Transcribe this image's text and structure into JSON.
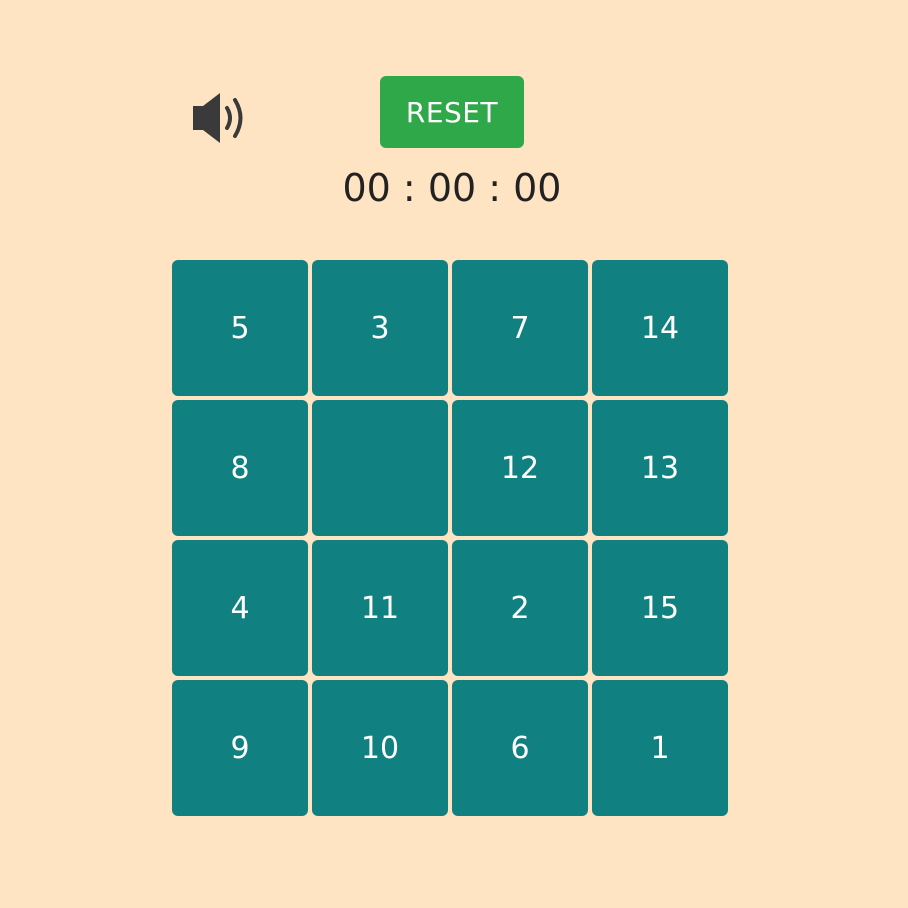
{
  "controls": {
    "sound_icon": "speaker-volume-icon",
    "reset_label": "RESET"
  },
  "timer": {
    "display": "00 : 00 : 00"
  },
  "board": {
    "rows": 4,
    "cols": 4,
    "tiles": [
      "5",
      "3",
      "7",
      "14",
      "8",
      "",
      "12",
      "13",
      "4",
      "11",
      "2",
      "15",
      "9",
      "10",
      "6",
      "1"
    ]
  },
  "colors": {
    "background": "#ffe4c4",
    "tile": "#118080",
    "reset_button": "#2fa84a",
    "text_dark": "#222222"
  }
}
